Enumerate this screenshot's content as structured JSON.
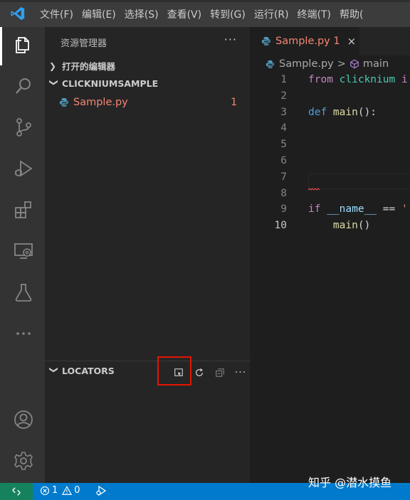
{
  "menubar": {
    "items": [
      "文件(F)",
      "编辑(E)",
      "选择(S)",
      "查看(V)",
      "转到(G)",
      "运行(R)",
      "终端(T)",
      "帮助("
    ]
  },
  "activity_bar": {
    "icons": [
      "explorer-icon",
      "search-icon",
      "source-control-icon",
      "run-debug-icon",
      "extensions-icon",
      "remote-explorer-icon",
      "testing-icon",
      "more-icon",
      "accounts-icon",
      "settings-gear-icon"
    ]
  },
  "sidebar": {
    "title": "资源管理器",
    "more": "···",
    "open_editors": "打开的编辑器",
    "project": "CLICKNIUMSAMPLE",
    "file": {
      "name": "Sample.py",
      "problems": "1"
    },
    "locators": {
      "title": "LOCATORS",
      "actions": [
        "capture-locator-icon",
        "refresh-icon",
        "collapse-all-icon",
        "more-icon"
      ],
      "more": "···"
    }
  },
  "editor": {
    "tab": {
      "name": "Sample.py 1",
      "close": "×"
    },
    "breadcrumb": {
      "file": "Sample.py",
      "separator": ">",
      "symbol": "main"
    },
    "lines": [
      {
        "n": "1",
        "tokens": [
          {
            "t": "from ",
            "c": "kw-purple"
          },
          {
            "t": "clicknium",
            "c": "ty"
          },
          {
            "t": " i",
            "c": "kw-purple"
          }
        ]
      },
      {
        "n": "2",
        "tokens": []
      },
      {
        "n": "3",
        "tokens": [
          {
            "t": "def ",
            "c": "kw-blue"
          },
          {
            "t": "main",
            "c": "fn"
          },
          {
            "t": "():",
            "c": "plain"
          }
        ]
      },
      {
        "n": "4",
        "tokens": []
      },
      {
        "n": "5",
        "tokens": []
      },
      {
        "n": "6",
        "tokens": []
      },
      {
        "n": "7",
        "tokens": []
      },
      {
        "n": "8",
        "tokens": []
      },
      {
        "n": "9",
        "tokens": [
          {
            "t": "if ",
            "c": "kw-purple"
          },
          {
            "t": "__name__",
            "c": "var"
          },
          {
            "t": " == ",
            "c": "plain"
          },
          {
            "t": "'",
            "c": "str"
          }
        ]
      },
      {
        "n": "10",
        "tokens": [
          {
            "t": "    main",
            "c": "fn"
          },
          {
            "t": "()",
            "c": "plain"
          }
        ]
      }
    ],
    "current_line": "10"
  },
  "statusbar": {
    "errors": "1",
    "warnings": "0"
  },
  "watermark": "知乎 @潜水摸鱼",
  "colors": {
    "accent": "#007acc",
    "error": "#f48771",
    "highlight_box": "#e51400",
    "remote": "#16825d"
  }
}
